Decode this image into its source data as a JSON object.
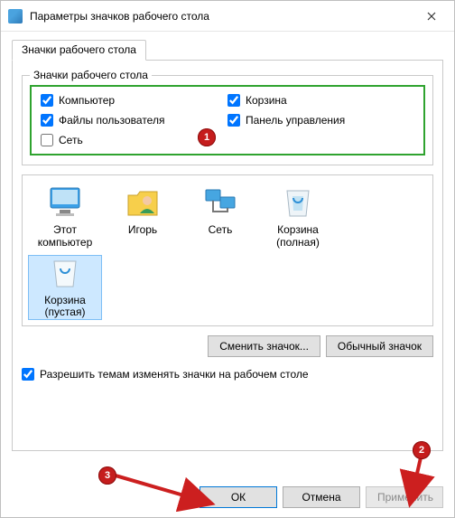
{
  "title": "Параметры значков рабочего стола",
  "tab_label": "Значки рабочего стола",
  "fieldset_legend": "Значки рабочего стола",
  "checkboxes": {
    "computer": {
      "label": "Компьютер",
      "checked": true
    },
    "userfiles": {
      "label": "Файлы пользователя",
      "checked": true
    },
    "network": {
      "label": "Сеть",
      "checked": false
    },
    "recycle": {
      "label": "Корзина",
      "checked": true
    },
    "cpanel": {
      "label": "Панель управления",
      "checked": true
    }
  },
  "icons": {
    "this_pc": "Этот компьютер",
    "igor": "Игорь",
    "network": "Сеть",
    "recycle_full": "Корзина (полная)",
    "recycle_empty": "Корзина (пустая)"
  },
  "buttons": {
    "change_icon": "Сменить значок...",
    "default_icon": "Обычный значок",
    "ok": "ОК",
    "cancel": "Отмена",
    "apply": "Применить"
  },
  "allow_themes_label": "Разрешить темам изменять значки на рабочем столе",
  "allow_themes_checked": true,
  "annotations": {
    "b1": "1",
    "b2": "2",
    "b3": "3"
  }
}
